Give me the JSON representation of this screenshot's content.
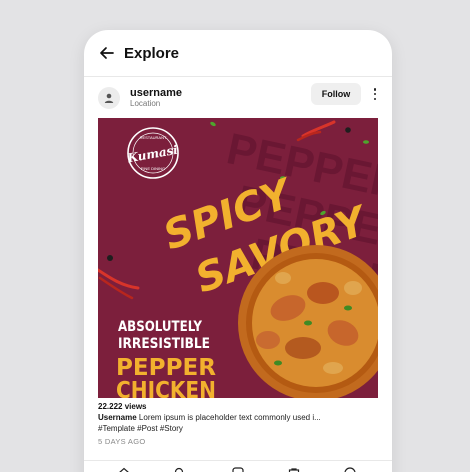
{
  "header": {
    "title": "Explore"
  },
  "user": {
    "username": "username",
    "location": "Location",
    "follow_label": "Follow"
  },
  "post": {
    "logo_text": "Kumasi",
    "logo_ring_top": "RESTAURANT",
    "logo_ring_bottom": "FINE DINING",
    "headline_1": "SPICY",
    "headline_2": "SAVORY",
    "tagline_1": "ABSOLUTELY",
    "tagline_2": "IRRESISTIBLE",
    "dish_1": "PEPPER",
    "dish_2": "CHICKEN",
    "bg_word": "PEPPER CHICKEN",
    "colors": {
      "background": "#7c1f3c",
      "accent": "#f2b12e",
      "bowl": "#c26a1e"
    }
  },
  "meta": {
    "views": "22.222 views",
    "caption_user": "Username",
    "caption_text": "Lorem ipsum is placeholder text commonly used i...",
    "hashtags": "#Template #Post #Story",
    "time": "5 DAYS AGO"
  },
  "nav": {
    "icons": [
      "home-icon",
      "search-icon",
      "reels-icon",
      "shop-icon",
      "profile-icon"
    ]
  }
}
